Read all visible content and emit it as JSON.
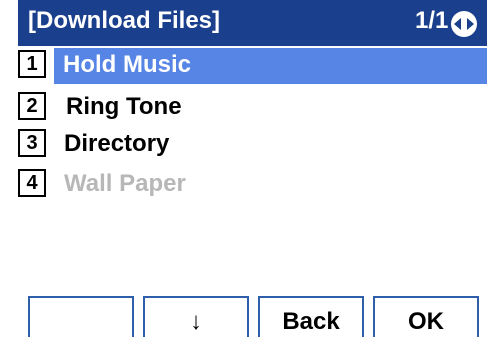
{
  "header": {
    "title": "[Download Files]",
    "page": "1/1",
    "nav_icon": "up-down-navigation-icon"
  },
  "menu": {
    "items": [
      {
        "number": "1",
        "label": "Hold Music",
        "state": "selected"
      },
      {
        "number": "2",
        "label": "Ring Tone",
        "state": "normal"
      },
      {
        "number": "3",
        "label": "Directory",
        "state": "normal"
      },
      {
        "number": "4",
        "label": "Wall Paper",
        "state": "disabled"
      }
    ]
  },
  "softkeys": [
    "",
    "↓",
    "Back",
    "OK"
  ],
  "colors": {
    "header_bg": "#1a3f8c",
    "selection": "#5785e6",
    "softkey_border": "#2f5faa",
    "disabled_text": "#b7b7b7"
  }
}
